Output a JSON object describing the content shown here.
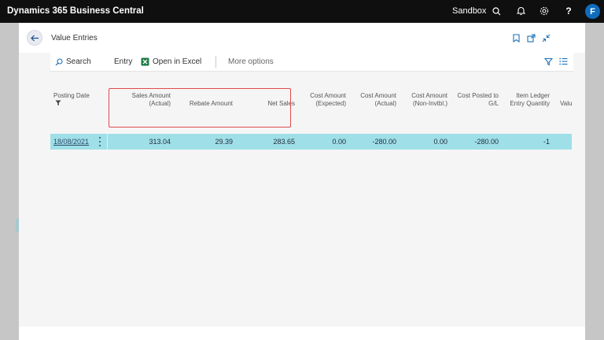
{
  "topbar": {
    "app_title": "Dynamics 365 Business Central",
    "environment": "Sandbox",
    "user_initial": "F",
    "icons": [
      "search-icon",
      "bell-icon",
      "gear-icon",
      "help-icon"
    ]
  },
  "page": {
    "title": "Value Entries"
  },
  "actions": {
    "search_label": "Search",
    "entry_label": "Entry",
    "excel_label": "Open in Excel",
    "more_label": "More options"
  },
  "table": {
    "columns": {
      "posting_date": "Posting Date",
      "sales_amount_1": "Sales Amount",
      "sales_amount_2": "(Actual)",
      "rebate_amount": "Rebate Amount",
      "net_sales": "Net Sales",
      "cost_expected_1": "Cost Amount",
      "cost_expected_2": "(Expected)",
      "cost_actual_1": "Cost Amount",
      "cost_actual_2": "(Actual)",
      "cost_noninv_1": "Cost Amount",
      "cost_noninv_2": "(Non-Invtbl.)",
      "cost_posted_1": "Cost Posted to",
      "cost_posted_2": "G/L",
      "item_ledger_1": "Item Ledger",
      "item_ledger_2": "Entry Quantity",
      "value_trunc": "Valu"
    },
    "rows": [
      {
        "posting_date": "18/08/2021",
        "sales_amount": "313.04",
        "rebate_amount": "29.39",
        "net_sales": "283.65",
        "cost_expected": "0.00",
        "cost_actual": "-280.00",
        "cost_noninv": "0.00",
        "cost_posted": "-280.00",
        "item_ledger_qty": "-1"
      }
    ]
  },
  "colors": {
    "topbar": "#0f0f0f",
    "accent": "#0f6cbd",
    "selected_row": "#9fdfe7",
    "highlight_box": "#e04b4b"
  }
}
